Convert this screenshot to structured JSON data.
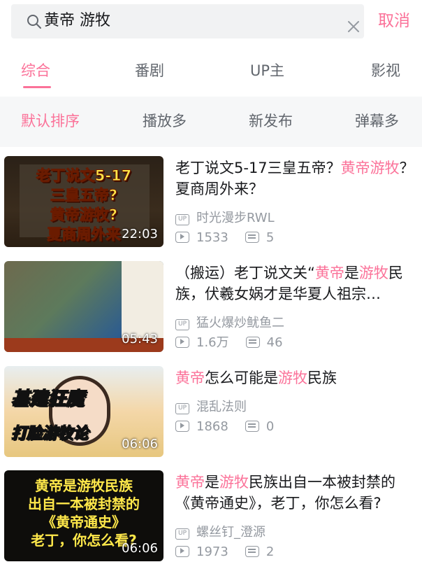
{
  "search": {
    "query": "黄帝 游牧",
    "cancel_label": "取消"
  },
  "tabs": [
    {
      "label": "综合",
      "active": true
    },
    {
      "label": "番剧",
      "active": false
    },
    {
      "label": "UP主",
      "active": false
    },
    {
      "label": "影视",
      "active": false
    }
  ],
  "sort": [
    {
      "label": "默认排序",
      "active": true
    },
    {
      "label": "播放多",
      "active": false
    },
    {
      "label": "新发布",
      "active": false
    },
    {
      "label": "弹幕多",
      "active": false
    }
  ],
  "accent_color": "#fb7299",
  "results": [
    {
      "title_parts": [
        {
          "text": "老丁说文5-17三皇五帝？",
          "hl": false
        },
        {
          "text": "黄帝游牧",
          "hl": true
        },
        {
          "text": "？夏商周外来？",
          "hl": false
        }
      ],
      "up_name": "时光漫步RWL",
      "plays": "1533",
      "danmaku": "5",
      "duration": "22:03",
      "thumb_lines": [
        "老丁说文5-17",
        "三皇五帝?",
        "黄帝游牧?",
        "夏商周外来"
      ]
    },
    {
      "title_parts": [
        {
          "text": "（搬运）老丁说文关“",
          "hl": false
        },
        {
          "text": "黄帝",
          "hl": true
        },
        {
          "text": "是",
          "hl": false
        },
        {
          "text": "游牧",
          "hl": true
        },
        {
          "text": "民族，伏羲女娲才是华夏人祖宗…",
          "hl": false
        }
      ],
      "up_name": "猛火爆炒鱿鱼二",
      "plays": "1.6万",
      "danmaku": "46",
      "duration": "05:43",
      "thumb_lines": []
    },
    {
      "title_parts": [
        {
          "text": "黄帝",
          "hl": true
        },
        {
          "text": "怎么可能是",
          "hl": false
        },
        {
          "text": "游牧",
          "hl": true
        },
        {
          "text": "民族",
          "hl": false
        }
      ],
      "up_name": "混乱法则",
      "plays": "1868",
      "danmaku": "0",
      "duration": "06:06",
      "thumb_lines": [
        "基建狂魔",
        "打脸游牧论"
      ]
    },
    {
      "title_parts": [
        {
          "text": "黄帝",
          "hl": true
        },
        {
          "text": "是",
          "hl": false
        },
        {
          "text": "游牧",
          "hl": true
        },
        {
          "text": "民族出自一本被封禁的《黄帝通史》，老丁，你怎么看?",
          "hl": false
        }
      ],
      "up_name": "螺丝钉_澄源",
      "plays": "1973",
      "danmaku": "2",
      "duration": "06:06",
      "thumb_lines": [
        "黄帝是游牧民族",
        "出自一本被封禁的",
        "《黄帝通史》",
        "老丁，你怎么看?"
      ]
    }
  ]
}
